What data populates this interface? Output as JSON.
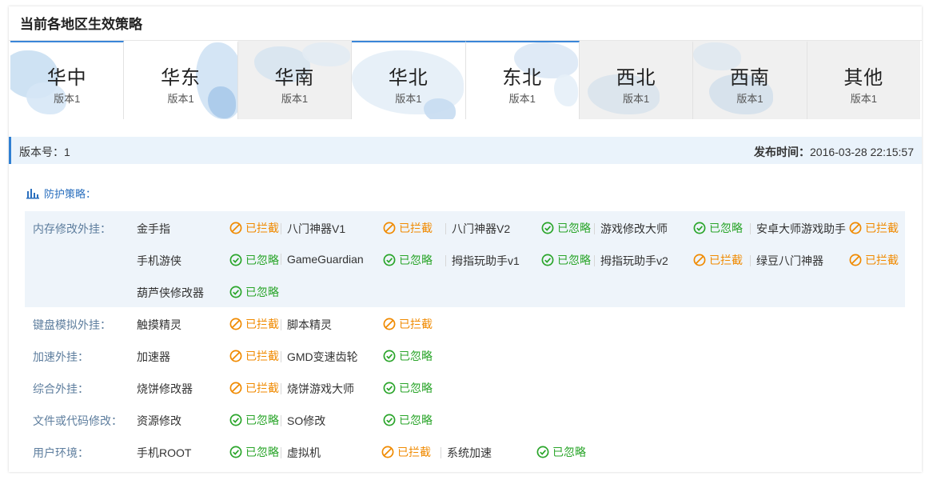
{
  "title": "当前各地区生效策略",
  "regions": [
    {
      "name": "华中",
      "version": "版本1",
      "style": "light",
      "active": true
    },
    {
      "name": "华东",
      "version": "版本1",
      "style": "light",
      "active": false
    },
    {
      "name": "华南",
      "version": "版本1",
      "style": "gray",
      "active": false
    },
    {
      "name": "华北",
      "version": "版本1",
      "style": "light",
      "active": true
    },
    {
      "name": "东北",
      "version": "版本1",
      "style": "light",
      "active": true
    },
    {
      "name": "西北",
      "version": "版本1",
      "style": "gray",
      "active": false
    },
    {
      "name": "西南",
      "version": "版本1",
      "style": "gray",
      "active": false
    },
    {
      "name": "其他",
      "version": "版本1",
      "style": "gray",
      "active": false
    }
  ],
  "version_bar": {
    "version_key": "版本号：",
    "version_value": "1",
    "publish_key": "发布时间：",
    "publish_value": "2016-03-28 22:15:57"
  },
  "section_title": "防护策略：",
  "status_labels": {
    "block": "已拦截",
    "ignore": "已忽略"
  },
  "colors": {
    "block": "#f08a00",
    "ignore": "#2aa52a",
    "accent": "#2f7fd2",
    "category": "#5e7e9e"
  },
  "groups": [
    {
      "category": "内存修改外挂：",
      "shaded": true,
      "rows": [
        [
          {
            "name": "金手指",
            "status": "block"
          },
          {
            "name": "八门神器V1",
            "status": "block"
          },
          {
            "name": "八门神器V2",
            "status": "ignore"
          },
          {
            "name": "游戏修改大师",
            "status": "ignore"
          },
          {
            "name": "安卓大师游戏助手",
            "status": "block"
          }
        ],
        [
          {
            "name": "手机游侠",
            "status": "ignore"
          },
          {
            "name": "GameGuardian",
            "status": "ignore"
          },
          {
            "name": "拇指玩助手v1",
            "status": "ignore"
          },
          {
            "name": "拇指玩助手v2",
            "status": "block"
          },
          {
            "name": "绿豆八门神器",
            "status": "block"
          }
        ],
        [
          {
            "name": "葫芦侠修改器",
            "status": "ignore"
          }
        ]
      ]
    },
    {
      "category": "键盘模拟外挂：",
      "shaded": false,
      "rows": [
        [
          {
            "name": "触摸精灵",
            "status": "block"
          },
          {
            "name": "脚本精灵",
            "status": "block"
          }
        ]
      ]
    },
    {
      "category": "加速外挂：",
      "shaded": false,
      "rows": [
        [
          {
            "name": "加速器",
            "status": "block"
          },
          {
            "name": "GMD变速齿轮",
            "status": "ignore"
          }
        ]
      ]
    },
    {
      "category": "综合外挂：",
      "shaded": false,
      "rows": [
        [
          {
            "name": "烧饼修改器",
            "status": "block"
          },
          {
            "name": "烧饼游戏大师",
            "status": "ignore"
          }
        ]
      ]
    },
    {
      "category": "文件或代码修改：",
      "shaded": false,
      "rows": [
        [
          {
            "name": "资源修改",
            "status": "ignore"
          },
          {
            "name": "SO修改",
            "status": "ignore"
          }
        ]
      ]
    },
    {
      "category": "用户环境：",
      "shaded": false,
      "rows": [
        [
          {
            "name": "手机ROOT",
            "status": "ignore"
          },
          {
            "name": "虚拟机",
            "status": "block"
          },
          {
            "name": "系统加速",
            "status": "ignore"
          }
        ]
      ]
    }
  ]
}
